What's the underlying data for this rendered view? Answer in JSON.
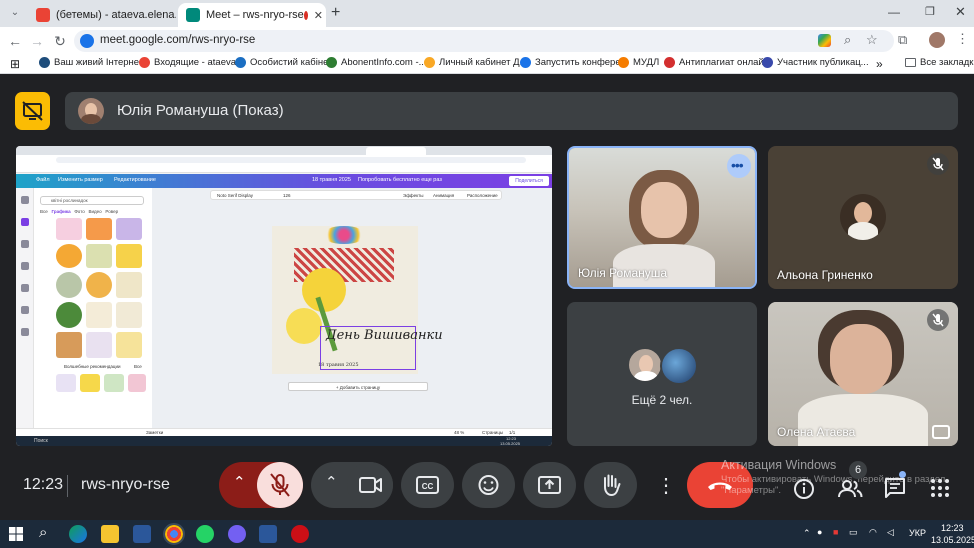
{
  "browser": {
    "tabs": [
      {
        "label": "(бетемы) - ataeva.elena.uipac",
        "active": false
      },
      {
        "label": "Meet – rws-nryo-rse",
        "active": true
      }
    ],
    "new_tab": "+",
    "url": "meet.google.com/rws-nryo-rse",
    "bookmarks": [
      "Ваш живий Інтерне...",
      "Входящие - ataeva...",
      "Особистий кабінет",
      "AbonentInfo.com -...",
      "Личный кабинет Д...",
      "Запустить конфере...",
      "МУДЛ",
      "Антиплагиат онлай...",
      "Участник публикац...",
      "Все закладки"
    ],
    "more_bookmarks": "»"
  },
  "meet": {
    "presenter": "Юлія Романуша (Показ)",
    "participants": [
      {
        "name": "Юлія Романуша"
      },
      {
        "name": "Альона Гриненко"
      },
      {
        "name": "Ещё 2 чел."
      },
      {
        "name": "Олена Атаєва"
      }
    ],
    "shared_screen": {
      "canva_title": "День Вишиванки",
      "canva_subtitle": "18 травня 2025",
      "add_page": "+ Добавить страницу",
      "zoom": "48 %",
      "pages": "Страницы",
      "page_num": "1/1",
      "notes": "Заметки",
      "share": "Поделиться",
      "design_menu": "Редактирование",
      "file_menu": "Файл",
      "resize_menu": "Изменить размер",
      "doc_title": "18 травня 2025",
      "try_free": "Попробовать бесплатно еще раз",
      "font_name": "Noto Serif Display",
      "font_size": "126",
      "effects": "Эффекты",
      "animation": "Анимация",
      "position": "Расположение",
      "search_placeholder": "квітні рослинадок",
      "side_tabs": [
        "Все",
        "Графика",
        "Фото",
        "Видео",
        "Ровер"
      ],
      "magic_recs": "Волшебные рекомендации",
      "all_label": "Все",
      "win_clock_time": "12:23",
      "win_clock_date": "13.05.2025",
      "search_label": "Поиск"
    }
  },
  "controls": {
    "time": "12:23",
    "meeting_code": "rws-nryo-rse",
    "participants_count": "6"
  },
  "windows_activation": {
    "title": "Активация Windows",
    "line1": "Чтобы активировать Windows, перейдите в раздел",
    "line2": "\"Параметры\"."
  },
  "taskbar": {
    "lang": "УКР",
    "time": "12:23",
    "date": "13.05.2025"
  },
  "colors": {
    "meet_bg": "#202124",
    "tile_bg": "#3c4043",
    "present_yellow": "#fbbc04",
    "end_call_red": "#ea4335",
    "mic_off_pink": "#f9dedc",
    "mic_off_dark": "#8c1d18",
    "active_speaker": "#8ab4f8"
  }
}
